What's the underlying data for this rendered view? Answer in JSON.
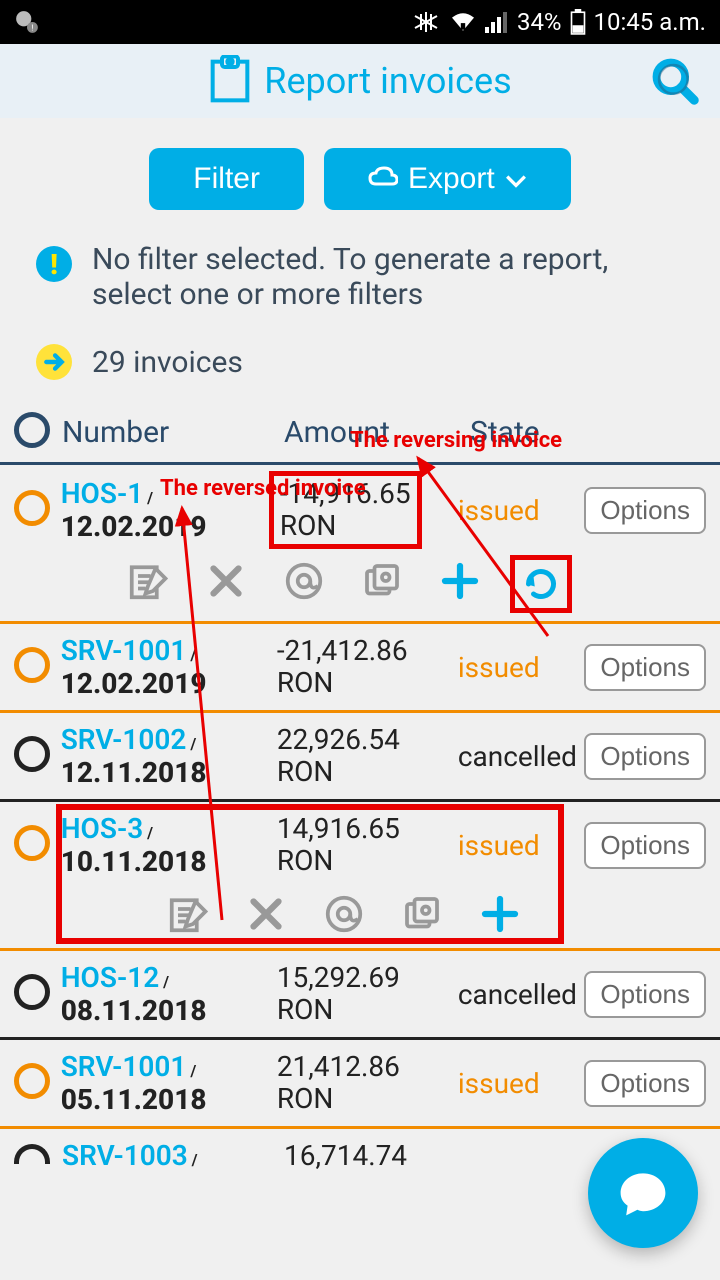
{
  "status_bar": {
    "battery_pct": "34%",
    "time": "10:45 a.m."
  },
  "header": {
    "title": "Report invoices"
  },
  "toolbar": {
    "filter_label": "Filter",
    "export_label": "Export"
  },
  "messages": {
    "no_filter": "No filter selected. To generate a report, select one or more filters",
    "count": "29 invoices"
  },
  "annotations": {
    "reversed": "The reversed invoice",
    "reversing": "The reversing invoice"
  },
  "columns": {
    "number": "Number",
    "amount": "Amount",
    "state": "State"
  },
  "options_label": "Options",
  "invoices": [
    {
      "number": "HOS-1",
      "date": "12.02.2019",
      "amount": "-14,916.65",
      "currency": "RON",
      "state": "issued",
      "select": "orange",
      "expanded": true,
      "highlight_amount": true,
      "highlight_undo": true,
      "border": "orange"
    },
    {
      "number": "SRV-1001",
      "date": "12.02.2019",
      "amount": "-21,412.86",
      "currency": "RON",
      "state": "issued",
      "select": "orange",
      "expanded": false,
      "highlight_amount": false,
      "highlight_undo": false,
      "border": "orange"
    },
    {
      "number": "SRV-1002",
      "date": "12.11.2018",
      "amount": "22,926.54",
      "currency": "RON",
      "state": "cancelled",
      "select": "dark",
      "expanded": false,
      "highlight_amount": false,
      "highlight_undo": false,
      "border": "dark"
    },
    {
      "number": "HOS-3",
      "date": "10.11.2018",
      "amount": "14,916.65",
      "currency": "RON",
      "state": "issued",
      "select": "orange",
      "expanded": true,
      "highlight_amount": false,
      "highlight_undo": false,
      "border": "orange",
      "highlight_row": true
    },
    {
      "number": "HOS-12",
      "date": "08.11.2018",
      "amount": "15,292.69",
      "currency": "RON",
      "state": "cancelled",
      "select": "dark",
      "expanded": false,
      "highlight_amount": false,
      "highlight_undo": false,
      "border": "dark"
    },
    {
      "number": "SRV-1001",
      "date": "05.11.2018",
      "amount": "21,412.86",
      "currency": "RON",
      "state": "issued",
      "select": "orange",
      "expanded": false,
      "highlight_amount": false,
      "highlight_undo": false,
      "border": "orange"
    },
    {
      "number": "SRV-1003",
      "date": "",
      "amount": "16,714.74",
      "currency": "",
      "state": "",
      "select": "dark",
      "expanded": false,
      "highlight_amount": false,
      "highlight_undo": false,
      "border": "none",
      "partial": true
    }
  ]
}
